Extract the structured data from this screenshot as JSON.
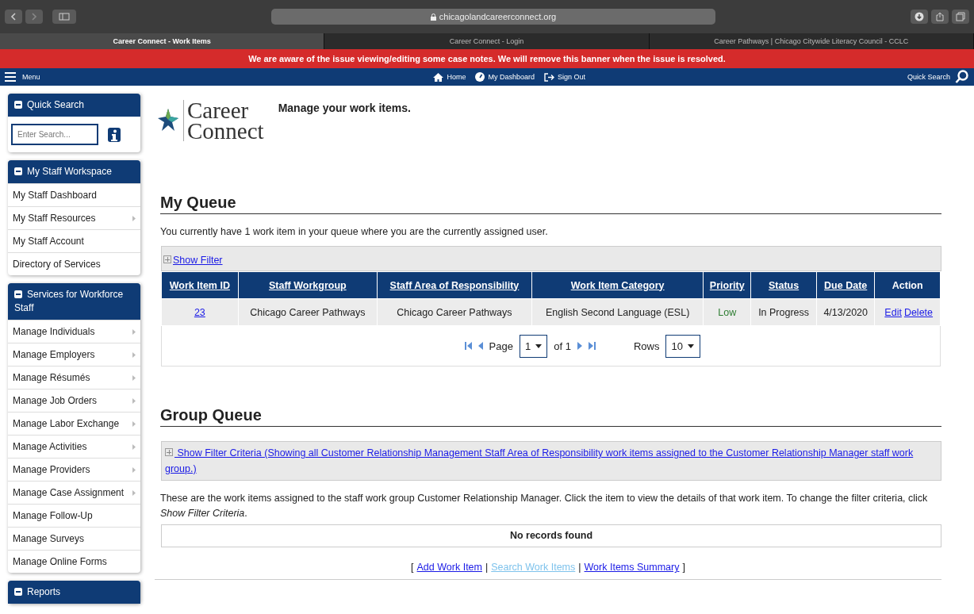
{
  "browser": {
    "url": "chicagolandcareerconnect.org",
    "tabs": [
      {
        "label": "Career Connect - Work Items",
        "selected": true
      },
      {
        "label": "Career Connect - Login",
        "selected": false
      },
      {
        "label": "Career Pathways | Chicago Citywide Literacy Council - CCLC",
        "selected": false
      }
    ]
  },
  "banner": "We are aware of the issue viewing/editing some case notes. We will remove this banner when the issue is resolved.",
  "navbar": {
    "menu": "Menu",
    "links": [
      {
        "kind": "home",
        "label": "Home"
      },
      {
        "kind": "dashboard",
        "label": "My Dashboard"
      },
      {
        "kind": "signout",
        "label": "Sign Out"
      }
    ],
    "quick_search": "Quick Search"
  },
  "sidebar": {
    "quick_search": {
      "title": "Quick Search",
      "placeholder": "Enter Search..."
    },
    "panels": [
      {
        "title": "My Staff Workspace",
        "items": [
          {
            "label": "My Staff Dashboard",
            "submenu": false
          },
          {
            "label": "My Staff Resources",
            "submenu": true
          },
          {
            "label": "My Staff Account",
            "submenu": false
          },
          {
            "label": "Directory of Services",
            "submenu": false
          }
        ]
      },
      {
        "title": "Services for Workforce Staff",
        "items": [
          {
            "label": "Manage Individuals",
            "submenu": true
          },
          {
            "label": "Manage Employers",
            "submenu": true
          },
          {
            "label": "Manage Résumés",
            "submenu": true
          },
          {
            "label": "Manage Job Orders",
            "submenu": true
          },
          {
            "label": "Manage Labor Exchange",
            "submenu": true
          },
          {
            "label": "Manage Activities",
            "submenu": true
          },
          {
            "label": "Manage Providers",
            "submenu": true
          },
          {
            "label": "Manage Case Assignment",
            "submenu": true
          },
          {
            "label": "Manage Follow-Up",
            "submenu": false
          },
          {
            "label": "Manage Surveys",
            "submenu": false
          },
          {
            "label": "Manage Online Forms",
            "submenu": false
          }
        ]
      },
      {
        "title": "Reports"
      }
    ]
  },
  "logo": {
    "line1": "Career",
    "line2": "Connect"
  },
  "page_title": "Manage your work items.",
  "my_queue": {
    "heading": "My Queue",
    "intro": "You currently have 1 work item in your queue where you are the currently assigned user.",
    "filter_link": "Show Filter",
    "columns": [
      "Work Item ID",
      "Staff Workgroup",
      "Staff Area of Responsibility",
      "Work Item Category",
      "Priority",
      "Status",
      "Due Date",
      "Action"
    ],
    "rows": [
      {
        "id": "23",
        "workgroup": "Chicago Career Pathways",
        "area": "Chicago Career Pathways",
        "category": "English Second Language (ESL)",
        "priority": "Low",
        "status": "In Progress",
        "due": "4/13/2020",
        "actions": [
          "Edit",
          "Delete"
        ]
      }
    ],
    "pager": {
      "page_label": "Page",
      "page": "1",
      "of_label": "of 1",
      "rows_label": "Rows",
      "rows": "10"
    }
  },
  "group_queue": {
    "heading": "Group Queue",
    "filter_link": "Show Filter Criteria (Showing all Customer Relationship Management Staff Area of Responsibility work items assigned to the Customer Relationship Manager staff work group.)",
    "intro": "These are the work items assigned to the staff work group Customer Relationship Manager. Click the item to view the details of that work item. To change the filter criteria, click *Show Filter Criteria*.",
    "empty": "No records found"
  },
  "footer_links": [
    {
      "kind": "text",
      "text": "["
    },
    {
      "kind": "link",
      "text": "Add Work Item",
      "disabled": false
    },
    {
      "kind": "text",
      "text": "|"
    },
    {
      "kind": "link",
      "text": "Search Work Items",
      "disabled": true
    },
    {
      "kind": "text",
      "text": "|"
    },
    {
      "kind": "link",
      "text": "Work Items Summary",
      "disabled": false
    },
    {
      "kind": "text",
      "text": "]"
    }
  ]
}
